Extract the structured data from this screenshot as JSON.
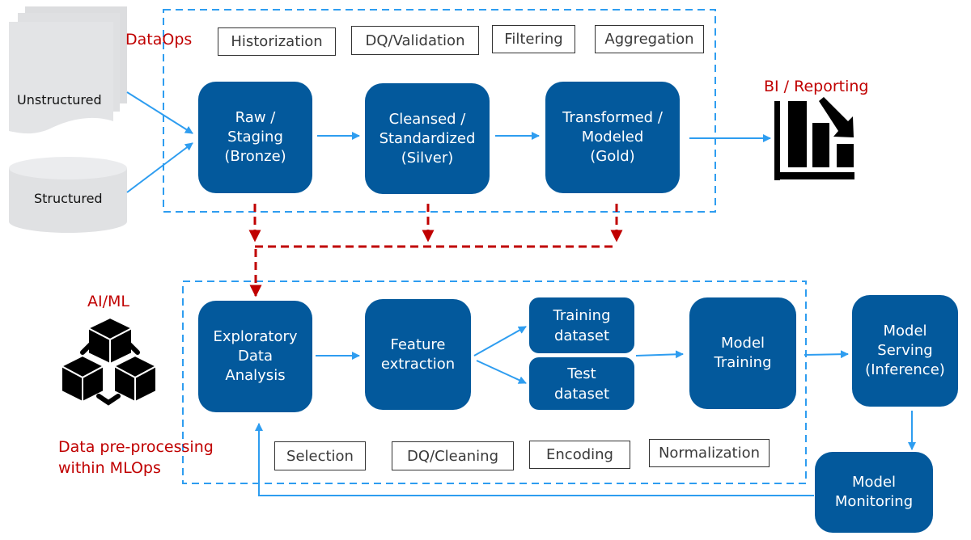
{
  "sections": {
    "dataops": {
      "title": "DataOps"
    },
    "mlops": {
      "title": "AI/ML",
      "subtitle": "Data pre-processing\nwithin MLOps"
    },
    "bi": {
      "title": "BI / Reporting"
    }
  },
  "sources": [
    {
      "label": "Unstructured",
      "icon": "document-stack-icon"
    },
    {
      "label": "Structured",
      "icon": "database-cylinder-icon"
    }
  ],
  "dataops_tags": [
    "Historization",
    "DQ/Validation",
    "Filtering",
    "Aggregation"
  ],
  "dataops_stages": [
    {
      "label": "Raw /\nStaging\n(Bronze)"
    },
    {
      "label": "Cleansed /\nStandardized\n(Silver)"
    },
    {
      "label": "Transformed /\nModeled\n(Gold)"
    }
  ],
  "mlops_stages": {
    "eda": "Exploratory\nData\nAnalysis",
    "feature": "Feature\nextraction",
    "training_dataset": "Training\ndataset",
    "test_dataset": "Test\ndataset",
    "model_training": "Model\nTraining",
    "model_serving": "Model\nServing\n(Inference)",
    "model_monitoring": "Model\nMonitoring"
  },
  "mlops_tags": [
    "Selection",
    "DQ/Cleaning",
    "Encoding",
    "Normalization"
  ],
  "colors": {
    "stage_fill": "#03599c",
    "flow_arrow": "#2e9df0",
    "dataops_handoff": "#c00000",
    "section_label": "#c00000",
    "source_fill": "#e3e4e6"
  }
}
